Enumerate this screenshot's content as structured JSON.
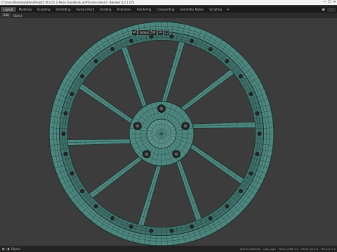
{
  "window": {
    "title": "C:\\Users\\Desktop\\BlendProj\\23 VLS 01 2-Piece Dualblock_with5cene.blend] - Blender 4.2.1 LTS",
    "minimize": "—",
    "maximize": "☐",
    "close": "✕"
  },
  "workspaces": {
    "tabs": [
      {
        "label": "Layout",
        "active": true
      },
      {
        "label": "Modeling",
        "active": false
      },
      {
        "label": "Sculpting",
        "active": false
      },
      {
        "label": "UV Editing",
        "active": false
      },
      {
        "label": "Texture Paint",
        "active": false
      },
      {
        "label": "Shading",
        "active": false
      },
      {
        "label": "Animation",
        "active": false
      },
      {
        "label": "Rendering",
        "active": false
      },
      {
        "label": "Compositing",
        "active": false
      },
      {
        "label": "Geometry Nodes",
        "active": false
      },
      {
        "label": "Scripting",
        "active": false
      }
    ],
    "add_label": "+"
  },
  "header": {
    "mode": "Edit",
    "menu_object": "Object"
  },
  "viewport_header": {
    "orientation": "Global"
  },
  "statusbar": {
    "mode_hint": "Object",
    "stats": [
      "Scene collection",
      "Cap_Logo",
      "Verts 2,968 /4.4",
      "Faces 2/2,4,6",
      "Tris 4,4, 5,5"
    ]
  },
  "theme": {
    "wheel_fill": "#4d867e",
    "wireframe": "#1c3734",
    "bolt": "#232725"
  }
}
